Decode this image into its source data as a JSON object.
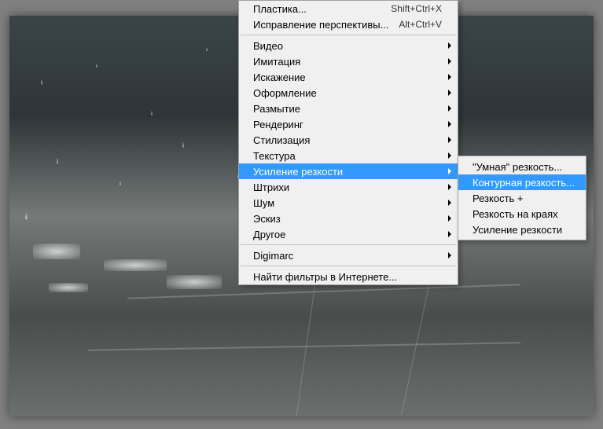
{
  "menu": {
    "items": [
      {
        "label": "Пластика...",
        "shortcut": "Shift+Ctrl+X",
        "type": "item"
      },
      {
        "label": "Исправление перспективы...",
        "shortcut": "Alt+Ctrl+V",
        "type": "item"
      },
      {
        "type": "separator"
      },
      {
        "label": "Видео",
        "type": "submenu"
      },
      {
        "label": "Имитация",
        "type": "submenu"
      },
      {
        "label": "Искажение",
        "type": "submenu"
      },
      {
        "label": "Оформление",
        "type": "submenu"
      },
      {
        "label": "Размытие",
        "type": "submenu"
      },
      {
        "label": "Рендеринг",
        "type": "submenu"
      },
      {
        "label": "Стилизация",
        "type": "submenu"
      },
      {
        "label": "Текстура",
        "type": "submenu"
      },
      {
        "label": "Усиление резкости",
        "type": "submenu",
        "highlighted": true
      },
      {
        "label": "Штрихи",
        "type": "submenu"
      },
      {
        "label": "Шум",
        "type": "submenu"
      },
      {
        "label": "Эскиз",
        "type": "submenu"
      },
      {
        "label": "Другое",
        "type": "submenu"
      },
      {
        "type": "separator"
      },
      {
        "label": "Digimarc",
        "type": "submenu"
      },
      {
        "type": "separator"
      },
      {
        "label": "Найти фильтры в Интернете...",
        "type": "item"
      }
    ]
  },
  "submenu": {
    "items": [
      {
        "label": "\"Умная\" резкость..."
      },
      {
        "label": "Контурная резкость...",
        "highlighted": true
      },
      {
        "label": "Резкость +"
      },
      {
        "label": "Резкость на краях"
      },
      {
        "label": "Усиление резкости"
      }
    ]
  }
}
